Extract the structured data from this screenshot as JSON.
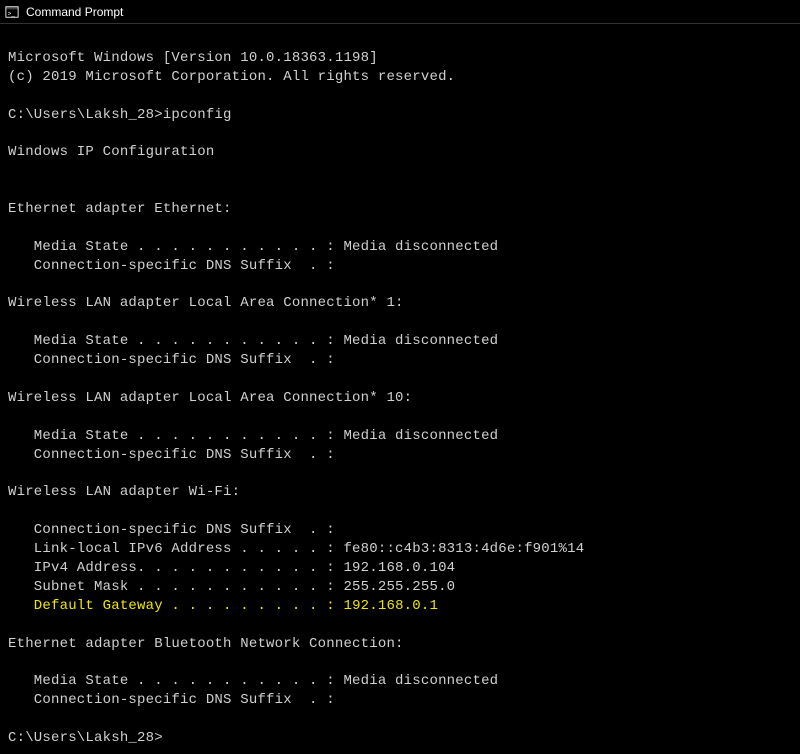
{
  "titlebar": {
    "title": "Command Prompt"
  },
  "terminal": {
    "version_line": "Microsoft Windows [Version 10.0.18363.1198]",
    "copyright_line": "(c) 2019 Microsoft Corporation. All rights reserved.",
    "prompt1": "C:\\Users\\Laksh_28>ipconfig",
    "header": "Windows IP Configuration",
    "adapters": {
      "ethernet": {
        "title": "Ethernet adapter Ethernet:",
        "media_state": "   Media State . . . . . . . . . . . : Media disconnected",
        "dns_suffix": "   Connection-specific DNS Suffix  . :"
      },
      "wlan1": {
        "title": "Wireless LAN adapter Local Area Connection* 1:",
        "media_state": "   Media State . . . . . . . . . . . : Media disconnected",
        "dns_suffix": "   Connection-specific DNS Suffix  . :"
      },
      "wlan10": {
        "title": "Wireless LAN adapter Local Area Connection* 10:",
        "media_state": "   Media State . . . . . . . . . . . : Media disconnected",
        "dns_suffix": "   Connection-specific DNS Suffix  . :"
      },
      "wifi": {
        "title": "Wireless LAN adapter Wi-Fi:",
        "dns_suffix": "   Connection-specific DNS Suffix  . :",
        "ipv6": "   Link-local IPv6 Address . . . . . : fe80::c4b3:8313:4d6e:f901%14",
        "ipv4": "   IPv4 Address. . . . . . . . . . . : 192.168.0.104",
        "subnet": "   Subnet Mask . . . . . . . . . . . : 255.255.255.0",
        "gateway_label": "   Default Gateway . . . . . . . . . : ",
        "gateway_value": "192.168.0.1"
      },
      "bluetooth": {
        "title": "Ethernet adapter Bluetooth Network Connection:",
        "media_state": "   Media State . . . . . . . . . . . : Media disconnected",
        "dns_suffix": "   Connection-specific DNS Suffix  . :"
      }
    },
    "prompt2": "C:\\Users\\Laksh_28>"
  }
}
